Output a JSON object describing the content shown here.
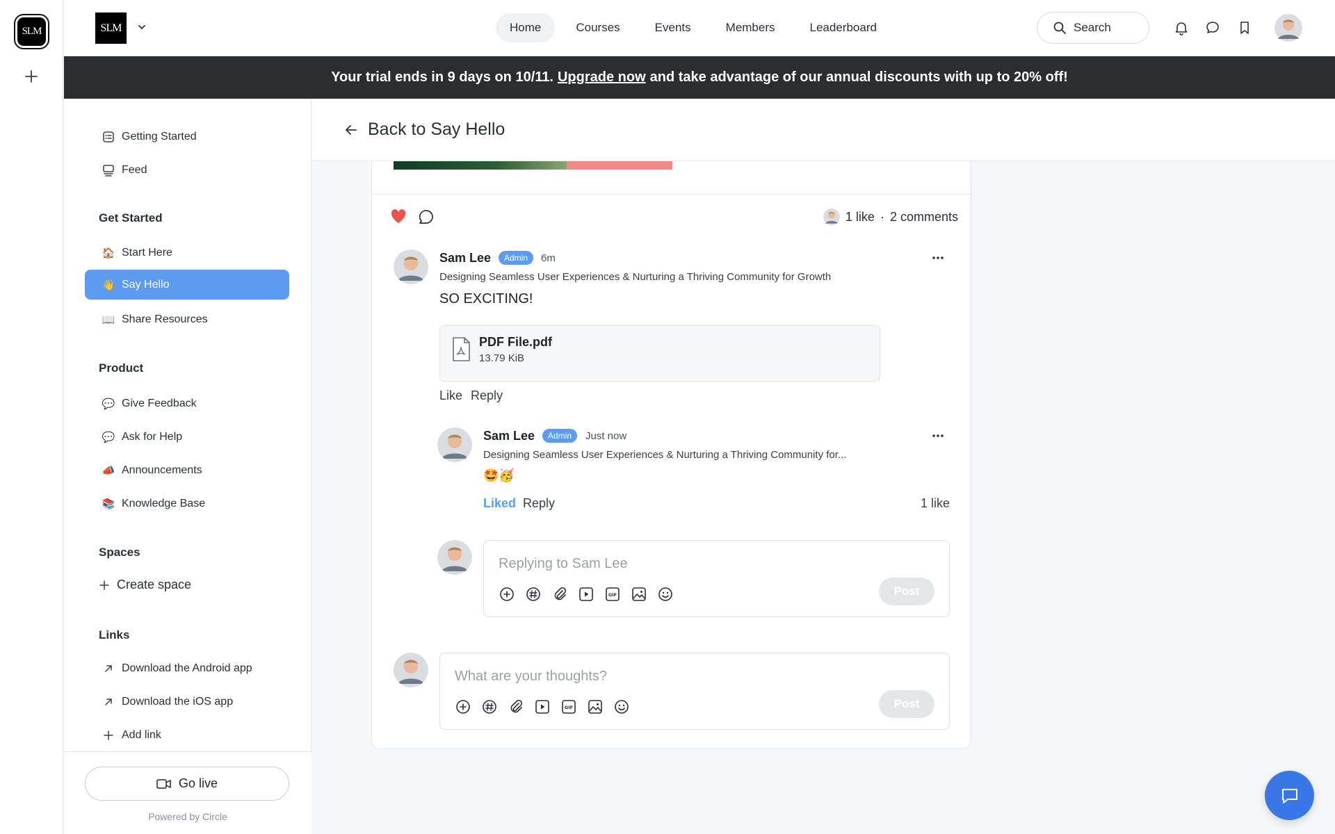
{
  "rail": {
    "logo_text": "SLM"
  },
  "header": {
    "brand_text": "SLM",
    "nav": [
      {
        "label": "Home",
        "active": true
      },
      {
        "label": "Courses"
      },
      {
        "label": "Events"
      },
      {
        "label": "Members"
      },
      {
        "label": "Leaderboard"
      }
    ],
    "search_label": "Search"
  },
  "banner": {
    "before": "Your trial ends in 9 days on 10/11.",
    "link": "Upgrade now",
    "after": "and take advantage of our annual discounts with up to 20% off!"
  },
  "sidebar": {
    "top_items": [
      {
        "label": "Getting Started",
        "icon": "checklist-icon"
      },
      {
        "label": "Feed",
        "icon": "feed-icon"
      }
    ],
    "sections": [
      {
        "heading": "Get Started",
        "items": [
          {
            "label": "Start Here",
            "emoji": "🏠"
          },
          {
            "label": "Say Hello",
            "emoji": "👋",
            "active": true
          },
          {
            "label": "Share Resources",
            "emoji": "📖"
          }
        ]
      },
      {
        "heading": "Product",
        "items": [
          {
            "label": "Give Feedback",
            "emoji": "💬"
          },
          {
            "label": "Ask for Help",
            "emoji": "💬"
          },
          {
            "label": "Announcements",
            "emoji": "📣"
          },
          {
            "label": "Knowledge Base",
            "emoji": "📚"
          }
        ]
      },
      {
        "heading": "Spaces",
        "items": [
          {
            "label": "Create space",
            "icon": "plus-icon"
          }
        ]
      },
      {
        "heading": "Links",
        "items": [
          {
            "label": "Download the Android app",
            "icon": "arrow-up-right-icon"
          },
          {
            "label": "Download the iOS app",
            "icon": "arrow-up-right-icon"
          },
          {
            "label": "Add link",
            "icon": "plus-icon"
          }
        ]
      }
    ],
    "go_live": "Go live",
    "powered_by": "Powered by Circle"
  },
  "back": {
    "label": "Back to Say Hello"
  },
  "post": {
    "likes_text": "1 like",
    "separator": "·",
    "comments_text": "2 comments"
  },
  "comment": {
    "author": "Sam Lee",
    "badge": "Admin",
    "time": "6m",
    "headline": "Designing Seamless User Experiences & Nurturing a Thriving Community for Growth",
    "body": "SO EXCITING!",
    "attachment": {
      "name": "PDF File.pdf",
      "size": "13.79 KiB"
    },
    "like_label": "Like",
    "reply_label": "Reply"
  },
  "reply": {
    "author": "Sam Lee",
    "badge": "Admin",
    "time": "Just now",
    "headline": "Designing Seamless User Experiences & Nurturing a Thriving Community for...",
    "body": "🤩🥳",
    "liked_label": "Liked",
    "reply_label": "Reply",
    "likes": "1 like"
  },
  "reply_composer": {
    "placeholder": "Replying to Sam Lee",
    "post_label": "Post"
  },
  "comment_composer": {
    "placeholder": "What are your thoughts?",
    "post_label": "Post"
  },
  "colors": {
    "accent": "#5b9cf0",
    "banner_bg": "#2b2d31",
    "heart": "#ef5350",
    "chat_button": "#3b78e7"
  }
}
